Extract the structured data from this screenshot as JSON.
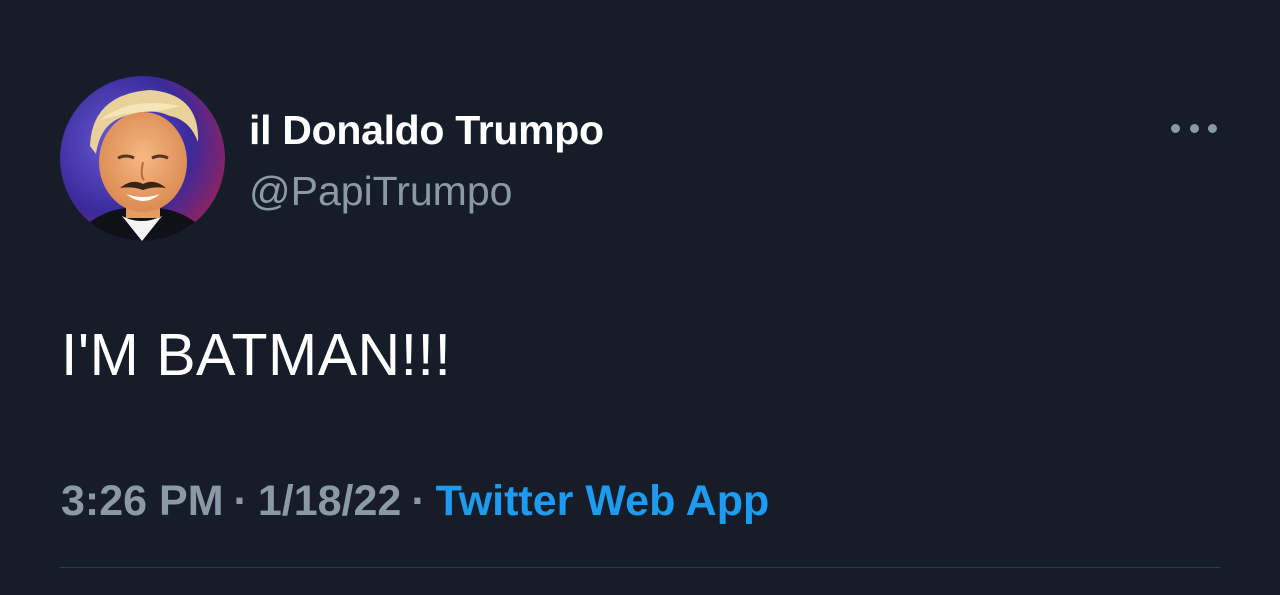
{
  "tweet": {
    "author": {
      "display_name": "il Donaldo Trumpo",
      "handle": "@PapiTrumpo"
    },
    "text": "I'M BATMAN!!!",
    "time": "3:26 PM",
    "separator": "·",
    "date": "1/18/22",
    "source": "Twitter Web App",
    "more_icon": "more-horizontal-icon"
  },
  "colors": {
    "background": "#161d29",
    "primary_text": "#ffffff",
    "secondary_text": "#8b98a5",
    "link": "#1d9bf0"
  }
}
